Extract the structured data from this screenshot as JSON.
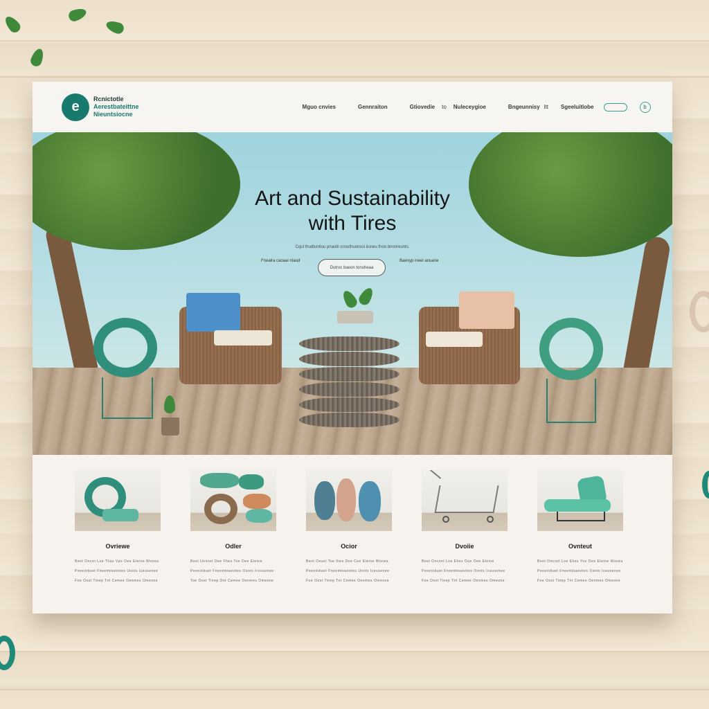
{
  "header": {
    "logo_letter": "e",
    "logo_line1": "Rcnictotle",
    "logo_line2": "Aerestbateittne",
    "logo_line3": "Nieuntsiocne",
    "nav": [
      "Mguo cnvies",
      "Gennraiton",
      "Gtiovedie",
      "Nuleceygioe",
      "Bngeunnisy",
      "Sgeeluitlobe"
    ],
    "nav_extra_1": "to",
    "nav_extra_2": "ltt",
    "circle_glyph": "b"
  },
  "hero": {
    "title_line1": "Art and Sustainability",
    "title_line2": "with Tires",
    "subtitle": "Cqul thudtuntiou pnaotii cnnuthuonsoi iiuneu fnoo bnonreunts.",
    "left_note": "Fnealra caoaai ntaud",
    "cta_label": "Dutroc baeon tonuheaa",
    "right_note": "Baeoyp ineel anuane"
  },
  "features": [
    {
      "title": "Ovriewe",
      "lines": [
        "Beet Oncrn Loe Thas Vpe Oee Eteine Wonea",
        "Peeeinbuet Fneemtoanotes Uonts Iceusenee",
        "Foe Oost Tinep Tnt Cemee Oenmes Omeone"
      ],
      "icon": "tire-cushion"
    },
    {
      "title": "Odler",
      "lines": [
        "Beet Uenoel Dee Fhes Toe Oee Eteine",
        "Peeeinbuet Fneemtoanotes Oonts Iceusenee",
        "Toe Oost Tinep Ont Cemee Oenmes Omeone"
      ],
      "icon": "tire-stack"
    },
    {
      "title": "Ocior",
      "lines": [
        "Beot Oeuel Toe Ihes Dne Cee Eteine Wonea",
        "Peeeinbuet Fneemtoanotes Uonts Iceusenee",
        "Foe Oost Tinep Tnt Cemee Oenmes Omeone"
      ],
      "icon": "tire-row"
    },
    {
      "title": "Dvoiie",
      "lines": [
        "Beet Oncnnl Loe Ehes Ooe Oee Eteine",
        "Peeeinbuet Fneemtoanotes Oonts Iceusenee",
        "Foe Oost Tinep Tnt Cemee Oenmes Omeone"
      ],
      "icon": "shopping-cart"
    },
    {
      "title": "Ovnteut",
      "lines": [
        "Beet Oncnnl Loe Ehes Yoe Oee Eteine Wonea",
        "Peeeinbuet Fneemtoanotes Oonts Iceusenee",
        "Foe Oost Tinep Tnt Cemee Oenmes Omeone"
      ],
      "icon": "chaise-lounge"
    }
  ],
  "colors": {
    "accent": "#177a6c",
    "panel": "#f6f3ee",
    "sky": "#b8dfe4"
  }
}
